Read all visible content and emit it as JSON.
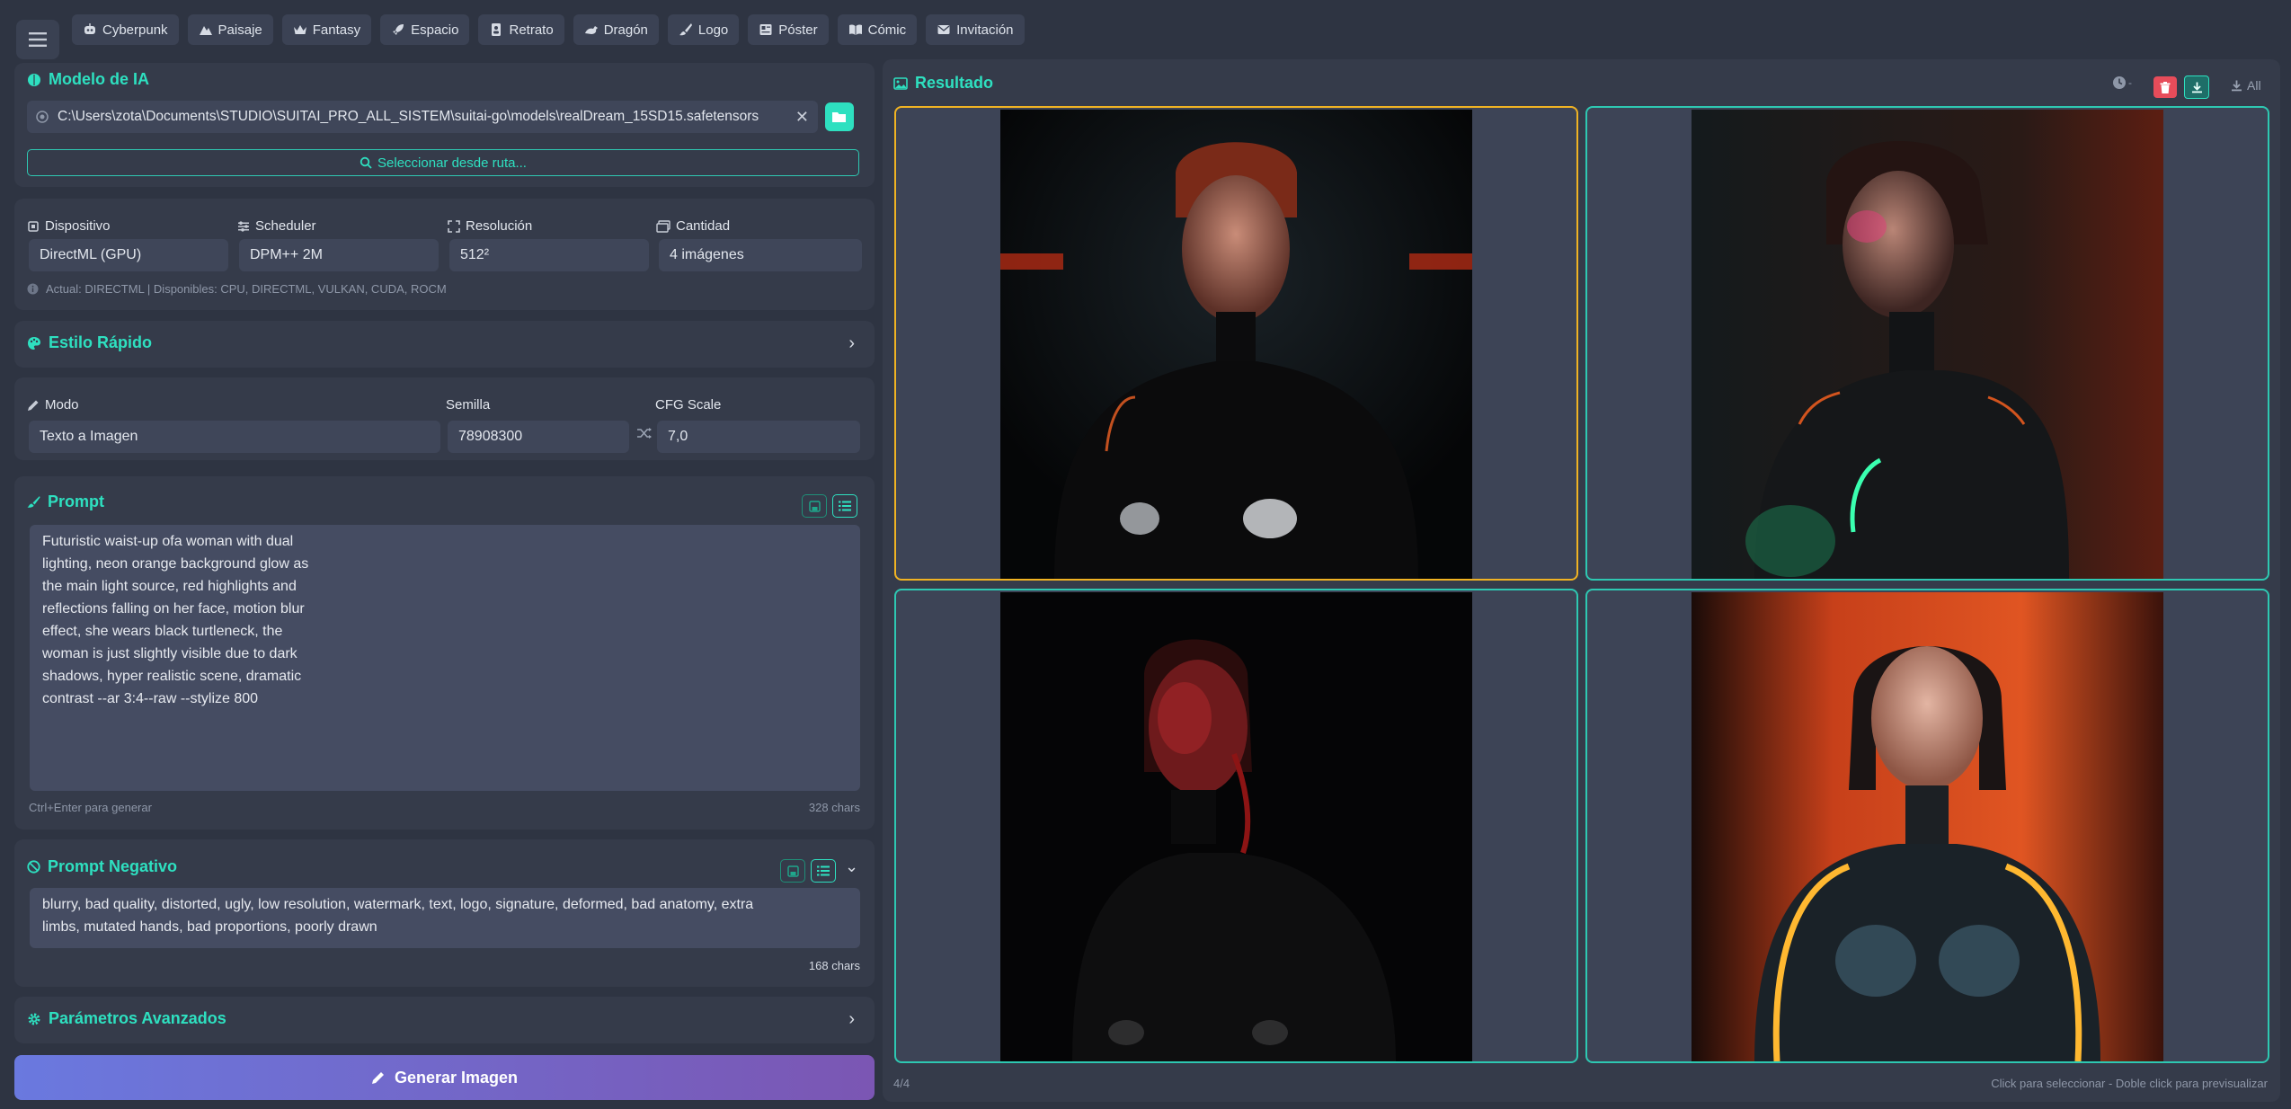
{
  "toolbar": {
    "presets": [
      {
        "label": "Cyberpunk",
        "icon": "robot-icon"
      },
      {
        "label": "Paisaje",
        "icon": "mountain-icon"
      },
      {
        "label": "Fantasy",
        "icon": "crown-icon"
      },
      {
        "label": "Espacio",
        "icon": "rocket-icon"
      },
      {
        "label": "Retrato",
        "icon": "portrait-icon"
      },
      {
        "label": "Dragón",
        "icon": "dragon-icon"
      },
      {
        "label": "Logo",
        "icon": "brush-icon"
      },
      {
        "label": "Póster",
        "icon": "poster-icon"
      },
      {
        "label": "Cómic",
        "icon": "book-icon"
      },
      {
        "label": "Invitación",
        "icon": "envelope-icon"
      }
    ]
  },
  "model": {
    "title": "Modelo de IA",
    "path": "C:\\Users\\zota\\Documents\\STUDIO\\SUITAI_PRO_ALL_SISTEM\\suitai-go\\models\\realDream_15SD15.safetensors",
    "select_label": "Seleccionar desde ruta..."
  },
  "settings": {
    "device_label": "Dispositivo",
    "device_value": "DirectML (GPU)",
    "scheduler_label": "Scheduler",
    "scheduler_value": "DPM++ 2M",
    "resolution_label": "Resolución",
    "resolution_value": "512²",
    "quantity_label": "Cantidad",
    "quantity_value": "4 imágenes",
    "info": "Actual: DIRECTML | Disponibles: CPU, DIRECTML, VULKAN, CUDA, ROCM"
  },
  "style": {
    "title": "Estilo Rápido"
  },
  "mode": {
    "mode_label": "Modo",
    "mode_value": "Texto a Imagen",
    "seed_label": "Semilla",
    "seed_value": "78908300",
    "cfg_label": "CFG Scale",
    "cfg_value": "7,0"
  },
  "prompt": {
    "title": "Prompt",
    "text": "Futuristic waist-up ofa woman with dual\nlighting, neon orange background glow as\nthe main light source, red highlights and\nreflections falling on her face, motion blur\neffect, she wears black turtleneck, the\nwoman is just slightly visible due to dark\nshadows, hyper realistic scene, dramatic\ncontrast --ar 3:4--raw --stylize 800",
    "hint": "Ctrl+Enter para generar",
    "count": "328 chars"
  },
  "negative": {
    "title": "Prompt Negativo",
    "text": "blurry, bad quality, distorted, ugly, low resolution, watermark, text, logo, signature, deformed, bad anatomy, extra\nlimbs, mutated hands, bad proportions, poorly drawn",
    "count": "168 chars"
  },
  "advanced": {
    "title": "Parámetros Avanzados"
  },
  "generate": {
    "label": "Generar Imagen"
  },
  "result": {
    "title": "Resultado",
    "all_label": "All",
    "counter": "4/4",
    "footer_hint": "Click para seleccionar - Doble click para previsualizar"
  },
  "colors": {
    "accent": "#2ee0c0",
    "selected_border": "#f0b323",
    "danger": "#e74c5a",
    "gradient_start": "#6a79df",
    "gradient_end": "#7b56b3"
  }
}
